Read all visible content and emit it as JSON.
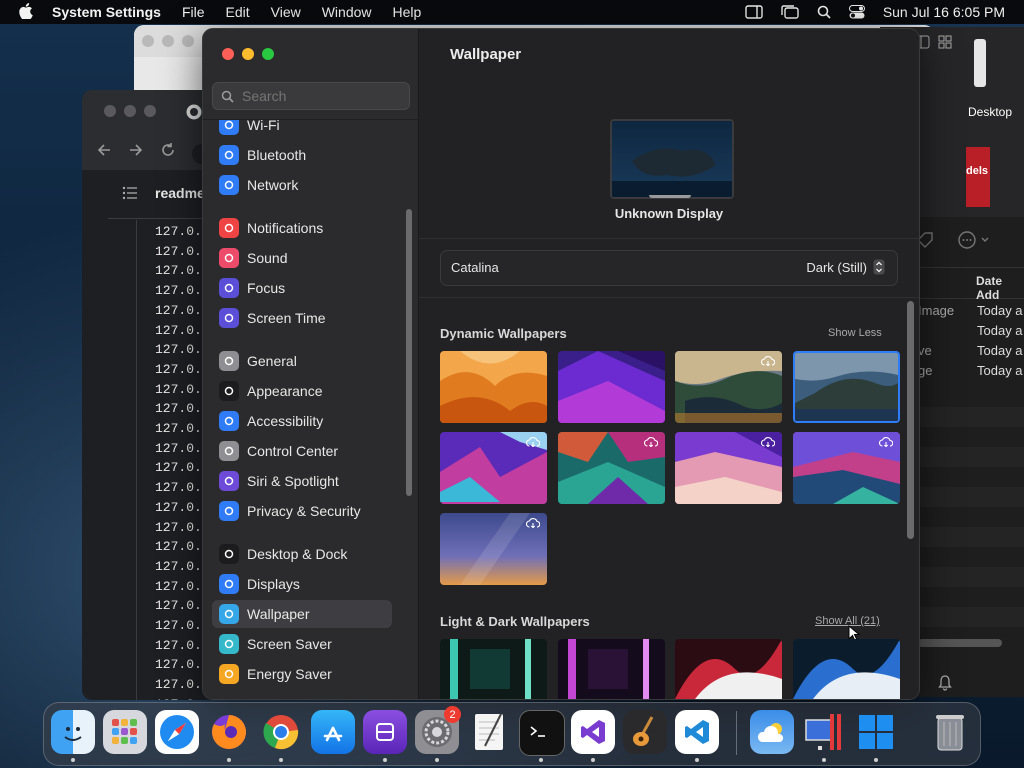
{
  "menubar": {
    "app_name": "System Settings",
    "menus": [
      "File",
      "Edit",
      "View",
      "Window",
      "Help"
    ],
    "clock": "Sun Jul 16  6:05 PM"
  },
  "background_windows": {
    "editor_tab": "readme",
    "editor_lines": [
      "127.0.",
      "127.0.",
      "127.0.",
      "127.0.",
      "127.0.",
      "127.0.",
      "127.0.",
      "127.0.",
      "127.0.",
      "127.0.",
      "127.0.",
      "127.0.",
      "127.0.",
      "127.0.",
      "127.0.",
      "127.0.",
      "127.0.",
      "127.0.",
      "127.0.",
      "127.0.",
      "127.0.",
      "127.0.",
      "127.0.",
      "127.0.",
      "127.0."
    ],
    "finder_header": "Date Add",
    "finder_rows": [
      {
        "name": "Image",
        "date": "Today a"
      },
      {
        "name": "",
        "date": "Today a"
      },
      {
        "name": "ve",
        "date": "Today a"
      },
      {
        "name": "ge",
        "date": "Today a"
      }
    ],
    "desktop_label": "Desktop",
    "desktop_label2": "dels"
  },
  "settings": {
    "search_placeholder": "Search",
    "sidebar": [
      {
        "label": "Wi-Fi",
        "color": "#2f7cf6"
      },
      {
        "label": "Bluetooth",
        "color": "#2f7cf6"
      },
      {
        "label": "Network",
        "color": "#2f7cf6"
      },
      {
        "label": "Notifications",
        "color": "#ef4444"
      },
      {
        "label": "Sound",
        "color": "#ec4b6a"
      },
      {
        "label": "Focus",
        "color": "#5b4fd8"
      },
      {
        "label": "Screen Time",
        "color": "#5b4fd8"
      },
      {
        "label": "General",
        "color": "#8e8e93"
      },
      {
        "label": "Appearance",
        "color": "#1c1c1e"
      },
      {
        "label": "Accessibility",
        "color": "#2f7cf6"
      },
      {
        "label": "Control Center",
        "color": "#8e8e93"
      },
      {
        "label": "Siri & Spotlight",
        "color": "#6d4bd8"
      },
      {
        "label": "Privacy & Security",
        "color": "#2f7cf6"
      },
      {
        "label": "Desktop & Dock",
        "color": "#1c1c1e"
      },
      {
        "label": "Displays",
        "color": "#2f7cf6"
      },
      {
        "label": "Wallpaper",
        "color": "#35a6e8"
      },
      {
        "label": "Screen Saver",
        "color": "#35b8c9"
      },
      {
        "label": "Energy Saver",
        "color": "#f5a623"
      }
    ],
    "selected": "Wallpaper",
    "title": "Wallpaper",
    "display_name": "Unknown Display",
    "wallpaper_name": "Catalina",
    "wallpaper_mode": "Dark (Still)",
    "section_dynamic": "Dynamic Wallpapers",
    "show_less": "Show Less",
    "section_light_dark": "Light & Dark Wallpapers",
    "show_all": "Show All (21)"
  },
  "dock": {
    "settings_badge": "2"
  }
}
